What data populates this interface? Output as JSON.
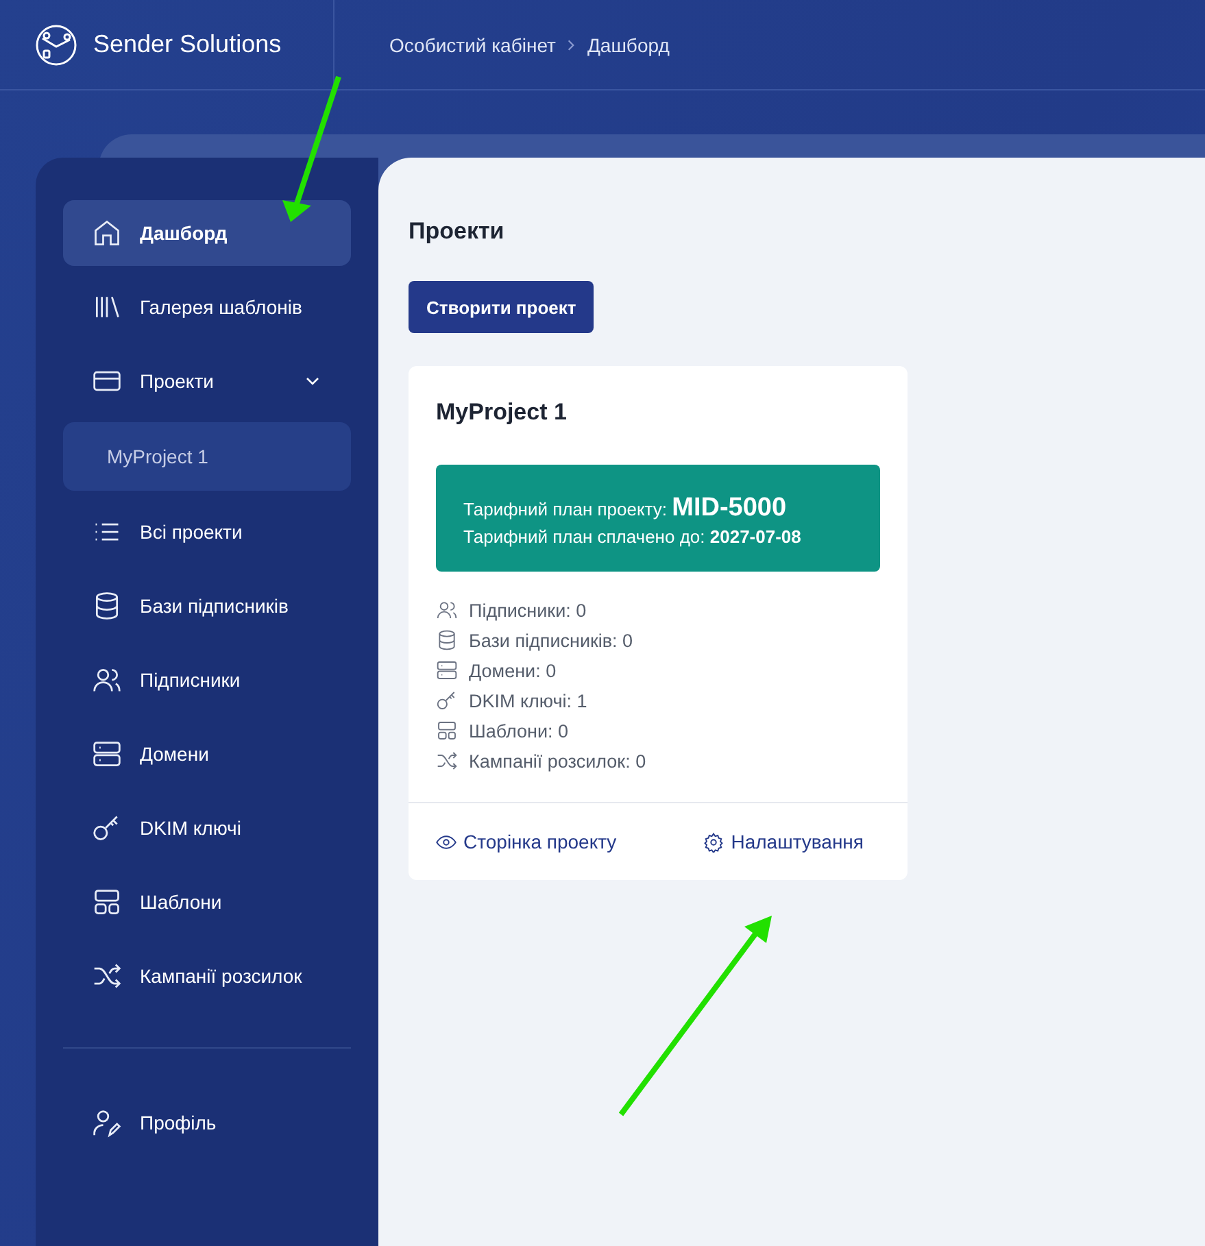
{
  "brand": {
    "name": "Sender Solutions"
  },
  "breadcrumb": [
    "Особистий кабінет",
    "Дашборд"
  ],
  "sidebar": {
    "items": [
      {
        "label": "Дашборд",
        "kind": "item",
        "selected": true
      },
      {
        "label": "Галерея шаблонів",
        "kind": "item",
        "selected": false
      },
      {
        "label": "Проекти",
        "kind": "group",
        "selected": false,
        "expanded": true,
        "children": [
          {
            "label": "MyProject 1",
            "selected": true
          }
        ]
      },
      {
        "label": "Всі проекти",
        "kind": "item",
        "selected": false
      },
      {
        "label": "Бази підписників",
        "kind": "item",
        "selected": false
      },
      {
        "label": "Підписники",
        "kind": "item",
        "selected": false
      },
      {
        "label": "Домени",
        "kind": "item",
        "selected": false
      },
      {
        "label": "DKIM ключі",
        "kind": "item",
        "selected": false
      },
      {
        "label": "Шаблони",
        "kind": "item",
        "selected": false
      },
      {
        "label": "Кампанії розсилок",
        "kind": "item",
        "selected": false
      }
    ],
    "footer_items": [
      {
        "label": "Профіль",
        "selected": false
      }
    ]
  },
  "page": {
    "title": "Проекти",
    "create_button": "Створити проект",
    "projects": [
      {
        "name": "MyProject 1",
        "plan_line": "Тарифний план проекту: **MID-5000**",
        "paid_line": "Тарифний план сплачено до: **2027-07-08**",
        "stats": [
          "Підписники: 0",
          "Бази підписників: 0",
          "Домени: 0",
          "DKIM ключі: 1",
          "Шаблони: 0",
          "Кампанії розсилок: 0"
        ],
        "actions": [
          "Сторінка проекту",
          "Налаштування"
        ]
      }
    ]
  }
}
